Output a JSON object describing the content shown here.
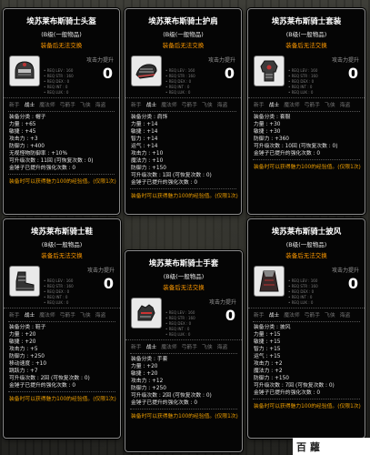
{
  "tooltips": [
    {
      "name": "埃苏莱布斯骑士头盔",
      "rank": "(B级(一般物品)",
      "trade": "装备后无法交换",
      "power_label": "攻击力提升",
      "power_value": "0",
      "req": [
        "• REQ LEV : 160",
        "• REQ STR : 160",
        "• REQ DEX : 0",
        "• REQ INT : 0",
        "• REQ LUK : 0"
      ],
      "jobs": [
        "新手",
        "战士",
        "魔法师",
        "弓箭手",
        "飞侠",
        "海盗"
      ],
      "active_job": 1,
      "lines": [
        "装备分类 : 帽子",
        "力量 : +65",
        "敏捷 : +45",
        "攻击力 : +3",
        "防御力 : +400",
        "无视怪物防御率 : +10%",
        "可升级次数 : 11回  (可恢复次数 : 0)",
        "金锤子已提升的强化次数 : 0"
      ],
      "foot": "装备时可以获得魅力100的经验值。(仅限1次)"
    },
    {
      "name": "埃苏莱布斯骑士护肩",
      "rank": "(B级(一般物品)",
      "trade": "装备后无法交换",
      "power_label": "攻击力提升",
      "power_value": "0",
      "req": [
        "• REQ LEV : 160",
        "• REQ STR : 160",
        "• REQ DEX : 0",
        "• REQ INT : 0",
        "• REQ LUK : 0"
      ],
      "jobs": [
        "新手",
        "战士",
        "魔法师",
        "弓箭手",
        "飞侠",
        "海盗"
      ],
      "active_job": 1,
      "lines": [
        "装备分类 : 肩饰",
        "力量 : +14",
        "敏捷 : +14",
        "智力 : +14",
        "运气 : +14",
        "攻击力 : +10",
        "魔法力 : +10",
        "防御力 : +150",
        "可升级次数 : 1回  (可恢复次数 : 0)",
        "金锤子已提升的强化次数 : 0"
      ],
      "foot": "装备时可以获得魅力100的经验值。(仅限1次)"
    },
    {
      "name": "埃苏莱布斯骑士套装",
      "rank": "(B级(一般物品)",
      "trade": "装备后无法交换",
      "power_label": "攻击力提升",
      "power_value": "0",
      "req": [
        "• REQ LEV : 160",
        "• REQ STR : 160",
        "• REQ DEX : 0",
        "• REQ INT : 0",
        "• REQ LUK : 0"
      ],
      "jobs": [
        "新手",
        "战士",
        "魔法师",
        "弓箭手",
        "飞侠",
        "海盗"
      ],
      "active_job": 1,
      "lines": [
        "装备分类 : 套服",
        "力量 : +30",
        "敏捷 : +30",
        "防御力 : +360",
        "可升级次数 : 10回  (可恢复次数 : 0)",
        "金锤子已提升的强化次数 : 0"
      ],
      "foot": "装备时可以获得魅力100的经验值。(仅限1次)"
    },
    {
      "name": "埃苏莱布斯骑士鞋",
      "rank": "(B级(一般物品)",
      "trade": "装备后无法交换",
      "power_label": "攻击力提升",
      "power_value": "0",
      "req": [
        "• REQ LEV : 160",
        "• REQ STR : 160",
        "• REQ DEX : 0",
        "• REQ INT : 0",
        "• REQ LUK : 0"
      ],
      "jobs": [
        "新手",
        "战士",
        "魔法师",
        "弓箭手",
        "飞侠",
        "海盗"
      ],
      "active_job": 1,
      "lines": [
        "装备分类 : 鞋子",
        "力量 : +20",
        "敏捷 : +20",
        "攻击力 : +5",
        "防御力 : +250",
        "移动速度 : +10",
        "跳跃力 : +7",
        "可升级次数 : 2回  (可恢复次数 : 0)",
        "金锤子已提升的强化次数 : 0"
      ],
      "foot": "装备时可以获得魅力100的经验值。(仅限1次)"
    },
    {
      "name": "埃苏莱布斯骑士手套",
      "rank": "(B级(一般物品)",
      "trade": "装备后无法交换",
      "power_label": "攻击力提升",
      "power_value": "0",
      "req": [
        "• REQ LEV : 160",
        "• REQ STR : 160",
        "• REQ DEX : 0",
        "• REQ INT : 0",
        "• REQ LUK : 0"
      ],
      "jobs": [
        "新手",
        "战士",
        "魔法师",
        "弓箭手",
        "飞侠",
        "海盗"
      ],
      "active_job": 1,
      "lines": [
        "装备分类 : 手套",
        "力量 : +20",
        "敏捷 : +20",
        "攻击力 : +12",
        "防御力 : +250",
        "可升级次数 : 2回  (可恢复次数 : 0)",
        "金锤子已提升的强化次数 : 0"
      ],
      "foot": "装备时可以获得魅力100的经验值。(仅限1次)"
    },
    {
      "name": "埃苏莱布斯骑士披风",
      "rank": "(B级(一般物品)",
      "trade": "装备后无法交换",
      "power_label": "攻击力提升",
      "power_value": "0",
      "req": [
        "• REQ LEV : 160",
        "• REQ STR : 160",
        "• REQ DEX : 0",
        "• REQ INT : 0",
        "• REQ LUK : 0"
      ],
      "jobs": [
        "新手",
        "战士",
        "魔法师",
        "弓箭手",
        "飞侠",
        "海盗"
      ],
      "active_job": 1,
      "lines": [
        "装备分类 : 披风",
        "力量 : +15",
        "敏捷 : +15",
        "智力 : +15",
        "运气 : +15",
        "攻击力 : +2",
        "魔法力 : +2",
        "防御力 : +150",
        "可升级次数 : 7回  (可恢复次数 : 0)",
        "金锤子已提升的强化次数 : 0"
      ],
      "foot": "装备时可以获得魅力100的经验值。(仅限1次)"
    }
  ],
  "icons": [
    "helmet-icon",
    "shoulder-icon",
    "armor-suit-icon",
    "boots-icon",
    "gloves-icon",
    "cape-icon"
  ],
  "watermark": "百 蘿"
}
